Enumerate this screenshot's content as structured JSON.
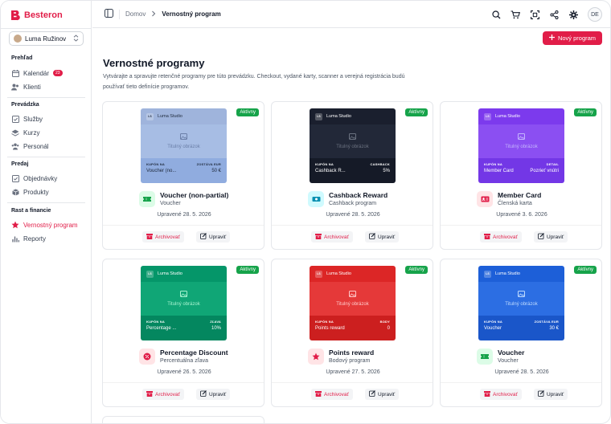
{
  "app": {
    "name": "Besteron"
  },
  "sidebar": {
    "branch": "Luma Ružinov",
    "sections": [
      {
        "title": "Prehľad",
        "items": [
          {
            "label": "Kalendár",
            "badge": "23"
          },
          {
            "label": "Klienti"
          }
        ]
      },
      {
        "title": "Prevádzka",
        "items": [
          {
            "label": "Služby"
          },
          {
            "label": "Kurzy"
          },
          {
            "label": "Personál"
          }
        ]
      },
      {
        "title": "Predaj",
        "items": [
          {
            "label": "Objednávky"
          },
          {
            "label": "Produkty"
          }
        ]
      },
      {
        "title": "Rast a financie",
        "items": [
          {
            "label": "Vernostný program"
          },
          {
            "label": "Reporty"
          }
        ]
      }
    ]
  },
  "topbar": {
    "breadcrumb_home": "Domov",
    "breadcrumb_current": "Vernostný program",
    "avatar": "DE"
  },
  "page": {
    "new_button": "Nový program",
    "title": "Vernostné programy",
    "description": "Vytvárajte a spravujte retenčné programy pre túto prevádzku. Checkout, vydané karty, scanner a verejná registrácia budú používať tieto definície programov."
  },
  "cards": [
    {
      "status": "Aktívny",
      "studio": "Luma Studio",
      "logo": "LS",
      "image_label": "Titulný obrázok",
      "left_label": "KUPÓN NA",
      "left_value": "Voucher (no...",
      "right_label": "ZOSTÁVA EUR",
      "right_value": "50 €",
      "name": "Voucher (non-partial)",
      "type": "Voucher",
      "updated": "Upravené 28. 5. 2026",
      "archive": "Archivovať",
      "edit": "Upraviť",
      "theme": {
        "head": "#9fb4dc",
        "mid": "#a7bde4",
        "foot": "#90acdf",
        "text": "#1e293b",
        "muted": "#6b7fa8"
      },
      "icon_color": "#16a34a",
      "icon_bg": "#dcfce7",
      "icon": "ticket-icon"
    },
    {
      "status": "Aktívny",
      "studio": "Luma Studio",
      "logo": "LS",
      "image_label": "Titulný obrázok",
      "left_label": "KUPÓN NA",
      "left_value": "Cashback R...",
      "right_label": "CASHBACK",
      "right_value": "5%",
      "name": "Cashback Reward",
      "type": "Cashback program",
      "updated": "Upravené 28. 5. 2026",
      "archive": "Archivovať",
      "edit": "Upraviť",
      "theme": {
        "head": "#1a1f2e",
        "mid": "#222838",
        "foot": "#151a27",
        "text": "#ffffff",
        "muted": "#6b7280"
      },
      "icon_color": "#0891b2",
      "icon_bg": "#cffafe",
      "icon": "cash-icon"
    },
    {
      "status": "Aktívny",
      "studio": "Luma Studio",
      "logo": "LS",
      "image_label": "Titulný obrázok",
      "left_label": "KUPÓN NA",
      "left_value": "Member Card",
      "right_label": "DETAIL",
      "right_value": "Pozrieť vnútri",
      "name": "Member Card",
      "type": "Členská karta",
      "updated": "Upravené 3. 6. 2026",
      "archive": "Archivovať",
      "edit": "Upraviť",
      "theme": {
        "head": "#7c3aed",
        "mid": "#8b4ff2",
        "foot": "#7337e6",
        "text": "#ffffff",
        "muted": "#c4b5fd"
      },
      "icon_color": "#e11d48",
      "icon_bg": "#ffe4e6",
      "icon": "id-card-icon"
    },
    {
      "status": "Aktívny",
      "studio": "Luma Studio",
      "logo": "LS",
      "image_label": "Titulný obrázok",
      "left_label": "KUPÓN NA",
      "left_value": "Percentage ...",
      "right_label": "ZĽAVA",
      "right_value": "10%",
      "name": "Percentage Discount",
      "type": "Percentuálna zľava",
      "updated": "Upravené 26. 5. 2026",
      "archive": "Archivovať",
      "edit": "Upraviť",
      "theme": {
        "head": "#059669",
        "mid": "#10a676",
        "foot": "#04875f",
        "text": "#ffffff",
        "muted": "#a7f3d0"
      },
      "icon_color": "#e11d48",
      "icon_bg": "#ffe4e6",
      "icon": "percent-icon"
    },
    {
      "status": "Aktívny",
      "studio": "Luma Studio",
      "logo": "LS",
      "image_label": "Titulný obrázok",
      "left_label": "KUPÓN NA",
      "left_value": "Points reward",
      "right_label": "BODY",
      "right_value": "0",
      "name": "Points reward",
      "type": "Bodový program",
      "updated": "Upravené 27. 5. 2026",
      "archive": "Archivovať",
      "edit": "Upraviť",
      "theme": {
        "head": "#dc2626",
        "mid": "#e53939",
        "foot": "#cc1f1f",
        "text": "#ffffff",
        "muted": "#fecaca"
      },
      "icon_color": "#e11d48",
      "icon_bg": "#ffe4e6",
      "icon": "star-icon"
    },
    {
      "status": "Aktívny",
      "studio": "Luma Studio",
      "logo": "LS",
      "image_label": "Titulný obrázok",
      "left_label": "KUPÓN NA",
      "left_value": "Voucher",
      "right_label": "ZOSTÁVA EUR",
      "right_value": "30 €",
      "name": "Voucher",
      "type": "Voucher",
      "updated": "Upravené 28. 5. 2026",
      "archive": "Archivovať",
      "edit": "Upraviť",
      "theme": {
        "head": "#1d5fd8",
        "mid": "#2c6ee3",
        "foot": "#1a56c9",
        "text": "#ffffff",
        "muted": "#bfdbfe"
      },
      "icon_color": "#16a34a",
      "icon_bg": "#dcfce7",
      "icon": "ticket-icon"
    }
  ],
  "colors": {
    "accent": "#e11d48",
    "active_status": "#16a34a"
  }
}
